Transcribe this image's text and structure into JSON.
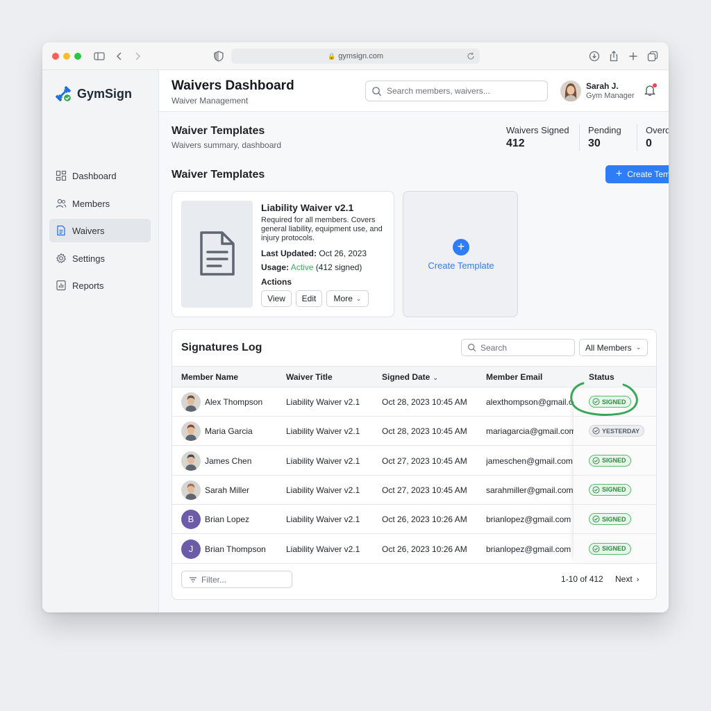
{
  "browser": {
    "url": "gymsign.com"
  },
  "brand": {
    "name": "GymSign"
  },
  "sidebar": {
    "items": [
      {
        "label": "Dashboard",
        "icon": "dashboard-icon"
      },
      {
        "label": "Members",
        "icon": "members-icon"
      },
      {
        "label": "Waivers",
        "icon": "document-icon",
        "active": true
      },
      {
        "label": "Settings",
        "icon": "gear-icon"
      },
      {
        "label": "Reports",
        "icon": "reports-icon"
      }
    ]
  },
  "header": {
    "title": "Waivers Dashboard",
    "subtitle": "Waiver Management",
    "search_placeholder": "Search members, waivers...",
    "user": {
      "name": "Sarah J.",
      "role": "Gym Manager"
    }
  },
  "summary": {
    "title": "Waiver Templates",
    "subtitle": "Waivers summary, dashboard",
    "stats": [
      {
        "label": "Waivers Signed",
        "value": "412"
      },
      {
        "label": "Pending",
        "value": "30"
      },
      {
        "label": "Overdue",
        "value": "0"
      }
    ]
  },
  "templates": {
    "heading": "Waiver Templates",
    "create_button": "Create Template",
    "card": {
      "title": "Liability Waiver v2.1",
      "description": "Required for all members. Covers general liability, equipment use, and injury protocols.",
      "last_updated_label": "Last Updated:",
      "last_updated": "Oct 26, 2023",
      "usage_label": "Usage:",
      "usage_status": "Active",
      "usage_count": "(412 signed)",
      "actions_label": "Actions",
      "actions": [
        "View",
        "Edit",
        "More"
      ]
    },
    "new_card_label": "Create Template"
  },
  "log": {
    "title": "Signatures Log",
    "search_placeholder": "Search",
    "filter_value": "All Members",
    "columns": [
      "Member Name",
      "Waiver Title",
      "Signed Date",
      "Member Email",
      "Status"
    ],
    "rows": [
      {
        "name": "Alex Thompson",
        "waiver": "Liability Waiver v2.1",
        "date": "Oct 28, 2023 10:45 AM",
        "email": "alexthompson@gmail.com",
        "status": "SIGNED",
        "avatar": "photo",
        "avatar_color": "#6b4f3f"
      },
      {
        "name": "Maria Garcia",
        "waiver": "Liability Waiver v2.1",
        "date": "Oct 28, 2023 10:45 AM",
        "email": "mariagarcia@gmail.com",
        "status": "YESTERDAY",
        "avatar": "photo",
        "avatar_color": "#8a4a3a"
      },
      {
        "name": "James Chen",
        "waiver": "Liability Waiver v2.1",
        "date": "Oct 27, 2023 10:45 AM",
        "email": "jameschen@gmail.com",
        "status": "SIGNED",
        "avatar": "photo",
        "avatar_color": "#3e4a55"
      },
      {
        "name": "Sarah Miller",
        "waiver": "Liability Waiver v2.1",
        "date": "Oct 27, 2023 10:45 AM",
        "email": "sarahmiller@gmail.com",
        "status": "SIGNED",
        "avatar": "photo",
        "avatar_color": "#9a7562"
      },
      {
        "name": "Brian Lopez",
        "waiver": "Liability Waiver v2.1",
        "date": "Oct 26, 2023 10:26 AM",
        "email": "brianlopez@gmail.com",
        "status": "SIGNED",
        "avatar": "B",
        "avatar_color": "#6b5ba8"
      },
      {
        "name": "Brian Thompson",
        "waiver": "Liability Waiver v2.1",
        "date": "Oct 26, 2023 10:26 AM",
        "email": "brianlopez@gmail.com",
        "status": "SIGNED",
        "avatar": "J",
        "avatar_color": "#6b5ba8"
      }
    ],
    "footer_filter_placeholder": "Filter...",
    "pagination": "1-10 of 412",
    "next_label": "Next"
  },
  "colors": {
    "accent": "#2e7cf6",
    "success": "#3aa757",
    "brand_blue": "#1e6fd9"
  }
}
